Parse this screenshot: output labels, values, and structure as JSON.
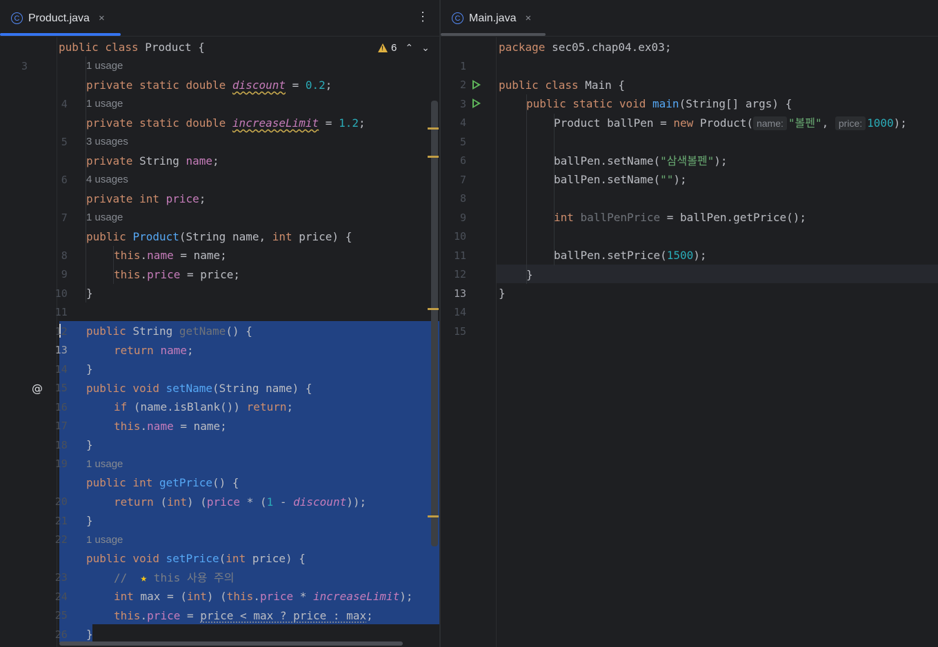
{
  "left_tab": {
    "icon": "C",
    "label": "Product.java",
    "close": "×"
  },
  "right_tab": {
    "icon": "C",
    "label": "Main.java",
    "close": "×"
  },
  "kebab": "⋮",
  "problems": {
    "count": "6",
    "up": "⌃",
    "down": "⌄"
  },
  "inlay_hints": {
    "name": "name:",
    "price": "price:"
  },
  "left_code": {
    "ln3": "3",
    "l3a": "public class ",
    "l3b": "Product {",
    "h1": "1 usage",
    "ln4": "4",
    "l4a": "private static double ",
    "l4b": "discount",
    "l4c": " = ",
    "l4d": "0.2",
    "l4e": ";",
    "h2": "1 usage",
    "ln5": "5",
    "l5a": "private static double ",
    "l5b": "increaseLimit",
    "l5c": " = ",
    "l5d": "1.2",
    "l5e": ";",
    "h3": "3 usages",
    "ln6": "6",
    "l6a": "private ",
    "l6b": "String ",
    "l6c": "name",
    "l6d": ";",
    "h4": "4 usages",
    "ln7": "7",
    "l7a": "private int ",
    "l7b": "price",
    "l7c": ";",
    "h5": "1 usage",
    "ln8": "8",
    "l8a": "public ",
    "l8b": "Product",
    "l8c": "(String name, ",
    "l8d": "int ",
    "l8e": "price) {",
    "ln9": "9",
    "l9a": "this",
    "l9b": ".",
    "l9c": "name",
    "l9d": " = name;",
    "ln10": "10",
    "l10a": "this",
    "l10b": ".",
    "l10c": "price",
    "l10d": " = price;",
    "ln11": "11",
    "l11a": "}",
    "ln12": "12",
    "ln13": "13",
    "l13a": "public ",
    "l13b": "String ",
    "l13c": "getName",
    "l13d": "() {",
    "ln14": "14",
    "l14a": "return ",
    "l14b": "name",
    "l14c": ";",
    "ln15": "15",
    "l15a": "}",
    "ln16": "16",
    "l16a": "public void ",
    "l16b": "setName",
    "l16c": "(String name) {",
    "ln17": "17",
    "l17a": "if ",
    "l17b": "(name.isBlank()) ",
    "l17c": "return",
    "l17d": ";",
    "ln18": "18",
    "l18a": "this",
    "l18b": ".",
    "l18c": "name",
    "l18d": " = name;",
    "ln19": "19",
    "l19a": "}",
    "h6": "1 usage",
    "ln20": "20",
    "l20a": "public int ",
    "l20b": "getPrice",
    "l20c": "() {",
    "ln21": "21",
    "l21a": "return ",
    "l21b": "(",
    "l21c": "int",
    "l21d": ") (",
    "l21e": "price",
    "l21f": " * (",
    "l21g": "1",
    "l21h": " - ",
    "l21i": "discount",
    "l21j": "));",
    "ln22": "22",
    "l22a": "}",
    "h7": "1 usage",
    "ln23": "23",
    "l23a": "public void ",
    "l23b": "setPrice",
    "l23c": "(",
    "l23d": "int ",
    "l23e": "price) {",
    "ln24": "24",
    "l24a": "//  ",
    "l24b": "★",
    "l24c": " this 사용 주의",
    "ln25": "25",
    "l25a": "int ",
    "l25b": "max = (",
    "l25c": "int",
    "l25d": ") (",
    "l25e": "this",
    "l25f": ".",
    "l25g": "price",
    "l25h": " * ",
    "l25i": "increaseLimit",
    "l25j": ");",
    "ln26": "26",
    "l26a": "this",
    "l26b": ".",
    "l26c": "price",
    "l26d": " = ",
    "l26e": "price < max ? price : max",
    "l26f": ";",
    "ln27": "27",
    "l27a": "}"
  },
  "right_code": {
    "ln1": "1",
    "r1a": "package ",
    "r1b": "sec05.chap04.ex03;",
    "ln2": "2",
    "ln3": "3",
    "r3a": "public class ",
    "r3b": "Main {",
    "ln4": "4",
    "r4a": "public static void ",
    "r4b": "main",
    "r4c": "(String[] args) {",
    "ln5": "5",
    "r5a": "Product ballPen = ",
    "r5b": "new ",
    "r5c": "Product(",
    "r5d": "\"볼펜\"",
    "r5e": ", ",
    "r5f": "1000",
    "r5g": ");",
    "ln6": "6",
    "ln7": "7",
    "r7a": "ballPen.setName(",
    "r7b": "\"삼색볼펜\"",
    "r7c": ");",
    "ln8": "8",
    "r8a": "ballPen.setName(",
    "r8b": "\"\"",
    "r8c": ");",
    "ln9": "9",
    "ln10": "10",
    "r10a": "int ",
    "r10b": "ballPenPrice",
    "r10c": " = ballPen.getPrice();",
    "ln11": "11",
    "ln12": "12",
    "r12a": "ballPen.setPrice(",
    "r12b": "1500",
    "r12c": ");",
    "ln13": "13",
    "r13a": "}",
    "ln14": "14",
    "r14a": "}",
    "ln15": "15"
  }
}
